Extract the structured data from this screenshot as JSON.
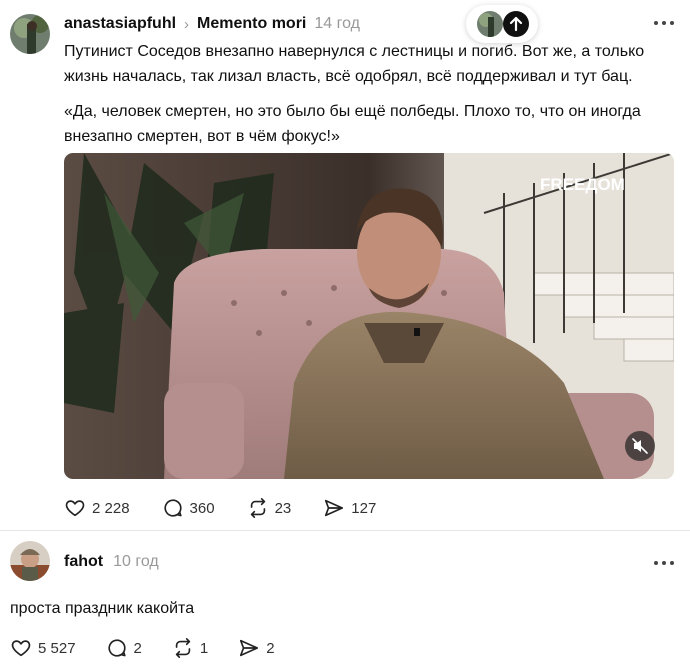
{
  "post": {
    "author": "anastasiapfuhl",
    "separator": "›",
    "topic": "Memento mori",
    "time": "14 год",
    "text": "Путинист Соседов внезапно навернулся с лестницы и погиб. Вот же, а только жизнь началась, так лизал власть, всё одобрял, всё поддерживал и тут бац.",
    "quote": "«Да, человек смертен, но это было бы ещё полбеды. Плохо то, что он иногда внезапно смертен, вот в чём фокус!»",
    "video": {
      "watermark": "FREEДOM"
    },
    "actions": {
      "likes": "2 228",
      "replies": "360",
      "reposts": "23",
      "shares": "127"
    }
  },
  "reply": {
    "author": "fahot",
    "time": "10 год",
    "text": "проста праздник какойта",
    "actions": {
      "likes": "5 527",
      "replies": "2",
      "reposts": "1",
      "shares": "2"
    }
  },
  "icons": {
    "more": "more-horizontal-icon",
    "scroll_top": "arrow-up-icon",
    "like": "heart-icon",
    "reply": "comment-bubble-icon",
    "repost": "repost-icon",
    "share": "send-icon",
    "mute": "muted-speaker-icon"
  },
  "colors": {
    "text": "#101010",
    "muted": "#999999",
    "divider": "#e6e6e6"
  }
}
